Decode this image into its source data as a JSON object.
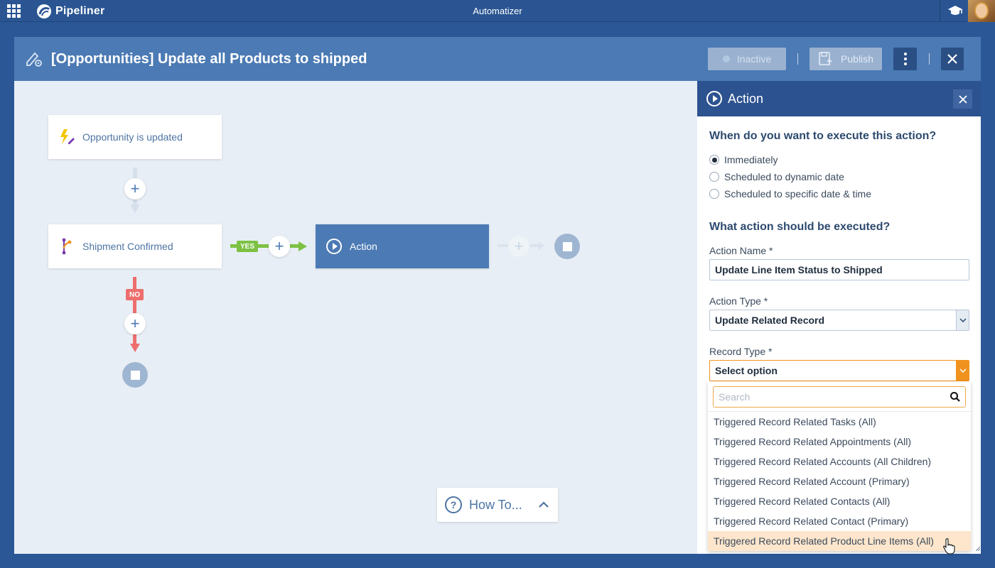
{
  "topbar": {
    "brand": "Pipeliner",
    "app_title": "Automatizer"
  },
  "header": {
    "title": "[Opportunities] Update all Products to shipped",
    "inactive_label": "Inactive",
    "publish_label": "Publish"
  },
  "canvas": {
    "trigger_label": "Opportunity is updated",
    "condition_label": "Shipment Confirmed",
    "yes_tag": "YES",
    "no_tag": "NO",
    "action_label": "Action",
    "howto_label": "How To..."
  },
  "panel": {
    "title": "Action",
    "when_question": "When do you want to execute this action?",
    "when_options": [
      {
        "label": "Immediately",
        "selected": true
      },
      {
        "label": "Scheduled to dynamic date",
        "selected": false
      },
      {
        "label": "Scheduled to specific date & time",
        "selected": false
      }
    ],
    "what_question": "What action should be executed?",
    "action_name_label": "Action Name *",
    "action_name_value": "Update Line Item Status to Shipped",
    "action_type_label": "Action Type *",
    "action_type_value": "Update Related Record",
    "record_type_label": "Record Type *",
    "record_type_value": "Select option"
  },
  "dropdown": {
    "search_placeholder": "Search",
    "items": [
      "Triggered Record Related Tasks (All)",
      "Triggered Record Related Appointments (All)",
      "Triggered Record Related Accounts (All Children)",
      "Triggered Record Related Account (Primary)",
      "Triggered Record Related Contacts (All)",
      "Triggered Record Related Contact (Primary)",
      "Triggered Record Related Product Line Items (All)"
    ],
    "hovered_index": 6
  },
  "colors": {
    "brand_blue": "#2a5592",
    "header_blue": "#4b7ab4",
    "yes_green": "#7cc142",
    "no_red": "#ee6e6e",
    "accent_orange": "#f0921e"
  }
}
